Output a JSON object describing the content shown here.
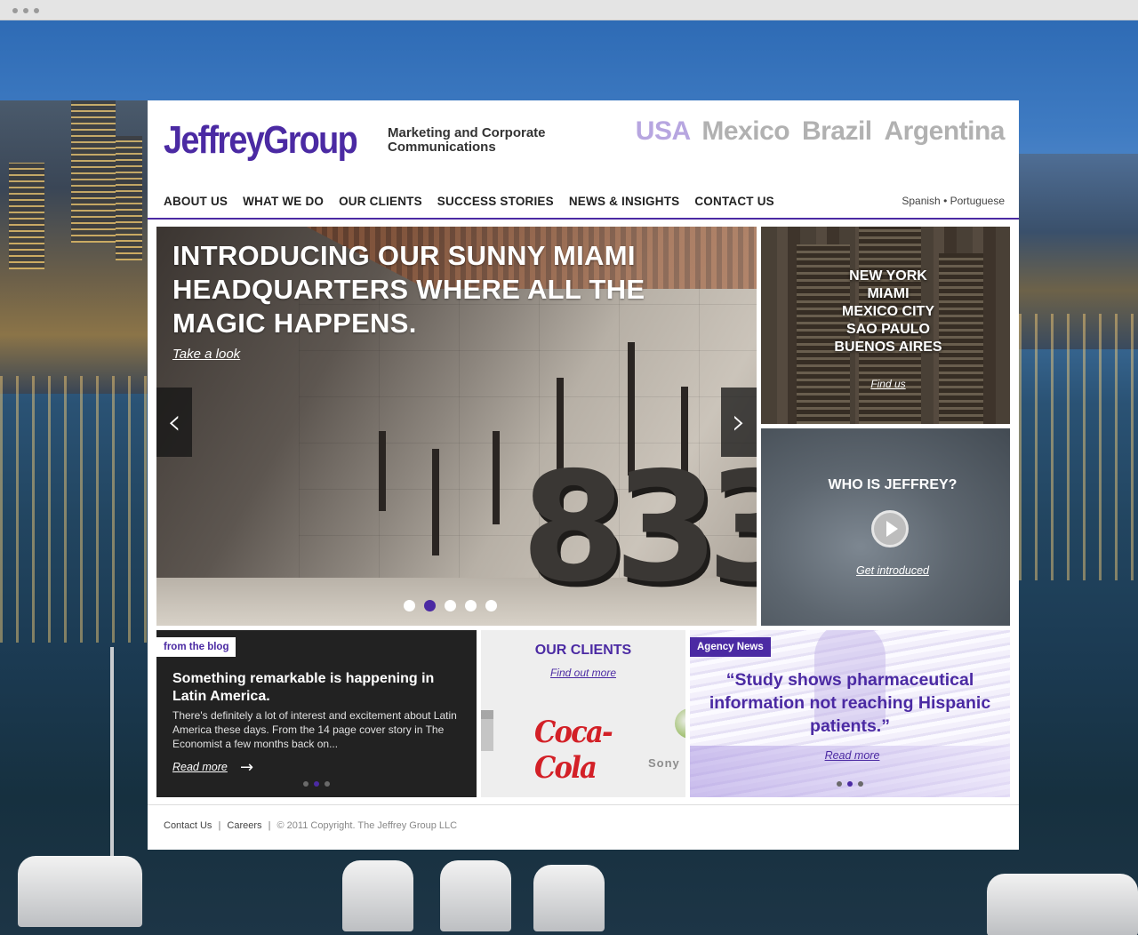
{
  "header": {
    "logo": "JeffreyGroup",
    "tagline_line1": "Marketing and Corporate",
    "tagline_line2": "Communications",
    "countries": [
      {
        "label": "USA",
        "active": true
      },
      {
        "label": "Mexico",
        "active": false
      },
      {
        "label": "Brazil",
        "active": false
      },
      {
        "label": "Argentina",
        "active": false
      }
    ]
  },
  "nav": {
    "items": [
      "ABOUT US",
      "WHAT WE DO",
      "OUR CLIENTS",
      "SUCCESS STORIES",
      "NEWS & INSIGHTS",
      "CONTACT US"
    ],
    "lang_spanish": "Spanish",
    "lang_sep": "•",
    "lang_portuguese": "Portuguese"
  },
  "hero": {
    "title": "INTRODUCING OUR SUNNY MIAMI HEADQUARTERS WHERE ALL THE MAGIC HAPPENS.",
    "link": "Take a look",
    "building_number": "833",
    "prev_icon": "‹",
    "next_icon": "›",
    "slide_count": 5,
    "active_slide": 2
  },
  "cities_tile": {
    "cities": [
      "NEW YORK",
      "MIAMI",
      "MEXICO CITY",
      "SAO PAULO",
      "BUENOS AIRES"
    ],
    "link": "Find us"
  },
  "who_tile": {
    "title": "WHO IS JEFFREY?",
    "link": "Get introduced"
  },
  "blog_tile": {
    "tag": "from the blog",
    "title": "Something remarkable is happening in Latin America.",
    "body": "There's definitely a lot of interest and excitement about Latin America these days. From the 14 page cover story in The Economist a few months back on...",
    "link": "Read more",
    "arrow": "→"
  },
  "clients_tile": {
    "title": "OUR CLIENTS",
    "link": "Find out more",
    "logo_coke": "Coca-Cola",
    "logo_sony": "Sony"
  },
  "news_tile": {
    "tag": "Agency News",
    "quote": "“Study shows pharmaceutical information not reaching Hispanic patients.”",
    "link": "Read more"
  },
  "footer": {
    "contact": "Contact Us",
    "sep": "|",
    "careers": "Careers",
    "copyright": "© 2011 Copyright. The Jeffrey Group LLC"
  },
  "colors": {
    "brand_purple": "#4b2aa3",
    "country_inactive": "#b1b1b1",
    "country_active": "#b7a6e0"
  }
}
